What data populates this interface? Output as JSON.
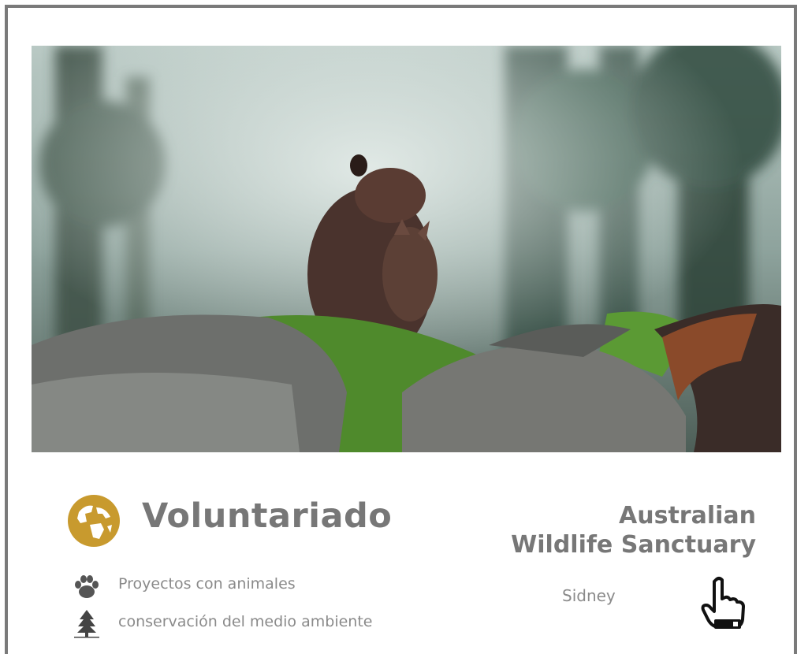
{
  "card": {
    "category_title": "Voluntariado",
    "features": [
      {
        "icon": "paw-icon",
        "label": "Proyectos con animales"
      },
      {
        "icon": "tree-icon",
        "label": "conservación del medio ambiente"
      }
    ],
    "organization_line1": "Australian",
    "organization_line2": "Wildlife Sanctuary",
    "city": "Sidney",
    "photo": "wallaby-on-rocks-photo",
    "globe_icon": "globe-icon",
    "action_icon": "pointing-hand-icon"
  },
  "colors": {
    "accent_gold": "#c89a2e",
    "text_gray": "#777777",
    "border_gray": "#7a7a7a"
  }
}
